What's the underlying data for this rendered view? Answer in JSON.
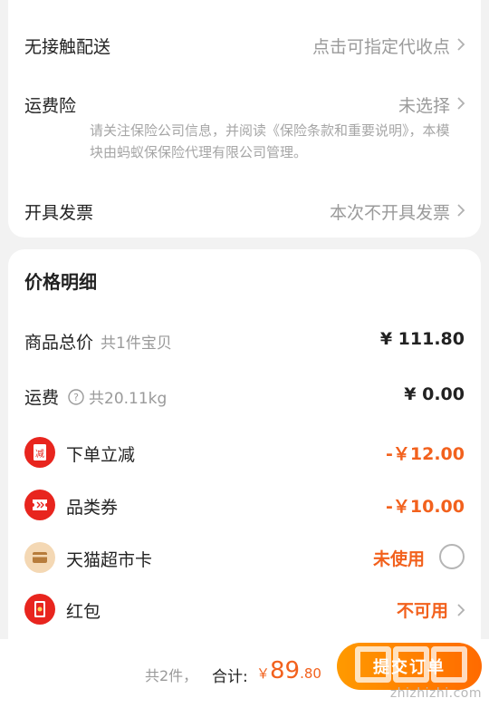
{
  "delivery": {
    "contactless_label": "无接触配送",
    "contactless_value": "点击可指定代收点",
    "insurance_label": "运费险",
    "insurance_value": "未选择",
    "insurance_note": "请关注保险公司信息，并阅读《保险条款和重要说明》，本模块由蚂蚁保保险代理有限公司管理。",
    "invoice_label": "开具发票",
    "invoice_value": "本次不开具发票"
  },
  "price_detail": {
    "title": "价格明细",
    "goods_total_label": "商品总价",
    "goods_total_sub": "共1件宝贝",
    "goods_total_amount": "¥ 111.80",
    "shipping_label": "运费",
    "shipping_sub": "共20.11kg",
    "shipping_amount": "¥ 0.00",
    "discounts": [
      {
        "icon": "instant-discount-icon",
        "icon_char": "减",
        "label": "下单立减",
        "amount": "-￥12.00",
        "color": "#e8251e"
      },
      {
        "icon": "category-coupon-icon",
        "label": "品类券",
        "amount": "-￥10.00",
        "color": "#e8251e"
      },
      {
        "icon": "tmall-card-icon",
        "label": "天猫超市卡",
        "amount": "未使用",
        "color": "#f4d8b4"
      },
      {
        "icon": "red-packet-icon",
        "label": "红包",
        "amount": "不可用",
        "color": "#e8251e"
      }
    ]
  },
  "footer": {
    "count": "共2件，",
    "total_label": "合计:",
    "currency": "￥",
    "total_int": "89",
    "total_dec": ".80",
    "submit_label": "提交订单"
  },
  "watermark": {
    "url": "zhizhizhi.com"
  },
  "colors": {
    "accent": "#f2611d",
    "red": "#e8251e",
    "button": "#ff7a00"
  }
}
